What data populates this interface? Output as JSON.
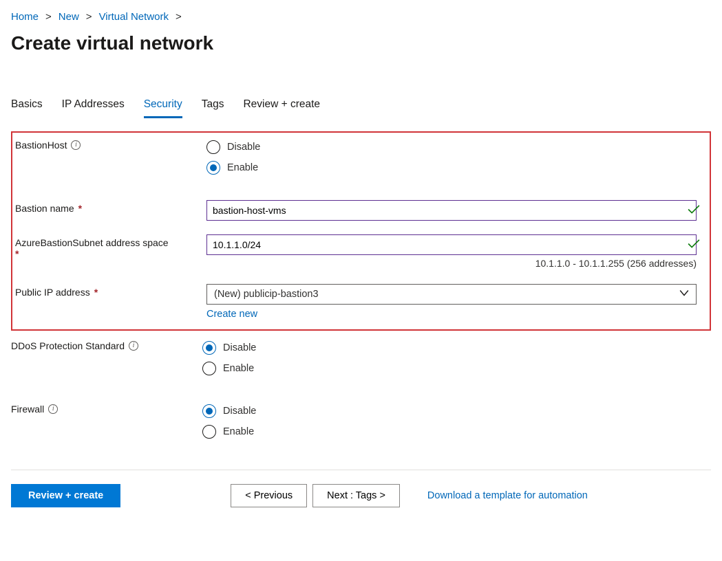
{
  "breadcrumbs": [
    "Home",
    "New",
    "Virtual Network"
  ],
  "page_title": "Create virtual network",
  "tabs": {
    "items": [
      "Basics",
      "IP Addresses",
      "Security",
      "Tags",
      "Review + create"
    ],
    "active_index": 2
  },
  "fields": {
    "bastion_host": {
      "label": "BastionHost",
      "options": {
        "disable": "Disable",
        "enable": "Enable"
      },
      "value": "enable"
    },
    "bastion_name": {
      "label": "Bastion name",
      "required": true,
      "value": "bastion-host-vms",
      "valid": true
    },
    "bastion_subnet": {
      "label": "AzureBastionSubnet address space",
      "required": true,
      "value": "10.1.1.0/24",
      "valid": true,
      "help": "10.1.1.0 - 10.1.1.255 (256 addresses)"
    },
    "public_ip": {
      "label": "Public IP address",
      "required": true,
      "selected": "(New) publicip-bastion3",
      "create_new": "Create new"
    },
    "ddos": {
      "label": "DDoS Protection Standard",
      "options": {
        "disable": "Disable",
        "enable": "Enable"
      },
      "value": "disable"
    },
    "firewall": {
      "label": "Firewall",
      "options": {
        "disable": "Disable",
        "enable": "Enable"
      },
      "value": "disable"
    }
  },
  "footer": {
    "review": "Review + create",
    "previous": "< Previous",
    "next": "Next : Tags >",
    "download": "Download a template for automation"
  }
}
